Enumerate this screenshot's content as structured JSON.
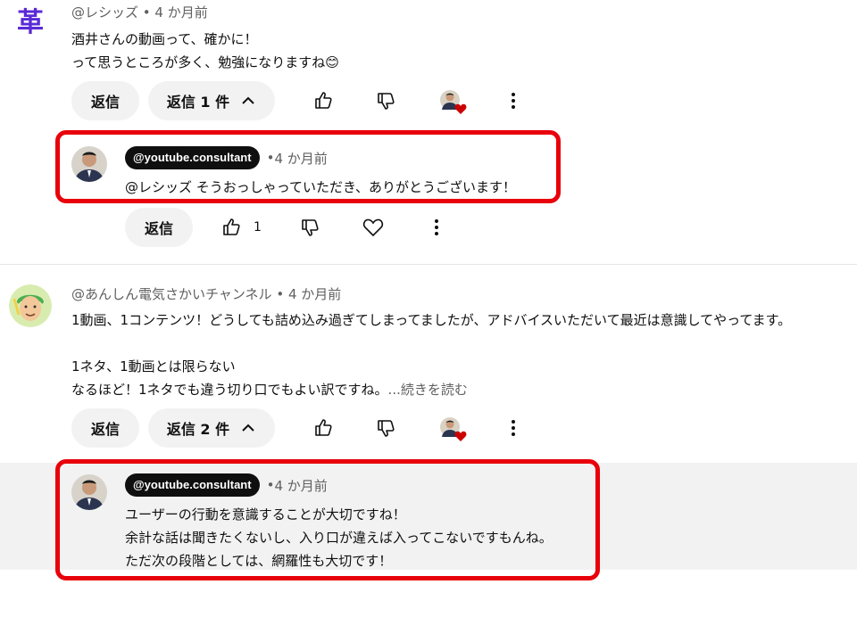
{
  "comments": [
    {
      "author": "@レシッズ",
      "time": "4 か月前",
      "avatar_char": "革",
      "lines": [
        "酒井さんの動画って、確かに！",
        "って思うところが多く、勉強になりますね😊"
      ],
      "actions": {
        "reply_label": "返信",
        "replies_label": "返信 1 件"
      },
      "reply": {
        "author": "@youtube.consultant",
        "time": "4 か月前",
        "lines": [
          "@レシッズ そうおっしゃっていただき、ありがとうございます！"
        ],
        "reply_label": "返信",
        "like_count": "1"
      }
    },
    {
      "author": "@あんしん電気さかいチャンネル",
      "time": "4 か月前",
      "lines": [
        "1動画、1コンテンツ！どうしても詰め込み過ぎてしまってましたが、アドバイスいただいて最近は意識してやってます。",
        "",
        "1ネタ、1動画とは限らない",
        "なるほど！1ネタでも違う切り口でもよい訳ですね。"
      ],
      "read_more": "...続きを読む",
      "actions": {
        "reply_label": "返信",
        "replies_label": "返信 2 件"
      },
      "reply": {
        "author": "@youtube.consultant",
        "time": "4 か月前",
        "lines": [
          "ユーザーの行動を意識することが大切ですね！",
          "余計な話は聞きたくないし、入り口が違えば入ってこないですもんね。",
          "ただ次の段階としては、網羅性も大切です！"
        ]
      }
    }
  ],
  "colors": {
    "highlight": "#e8000b",
    "heart": "#cc0000"
  }
}
